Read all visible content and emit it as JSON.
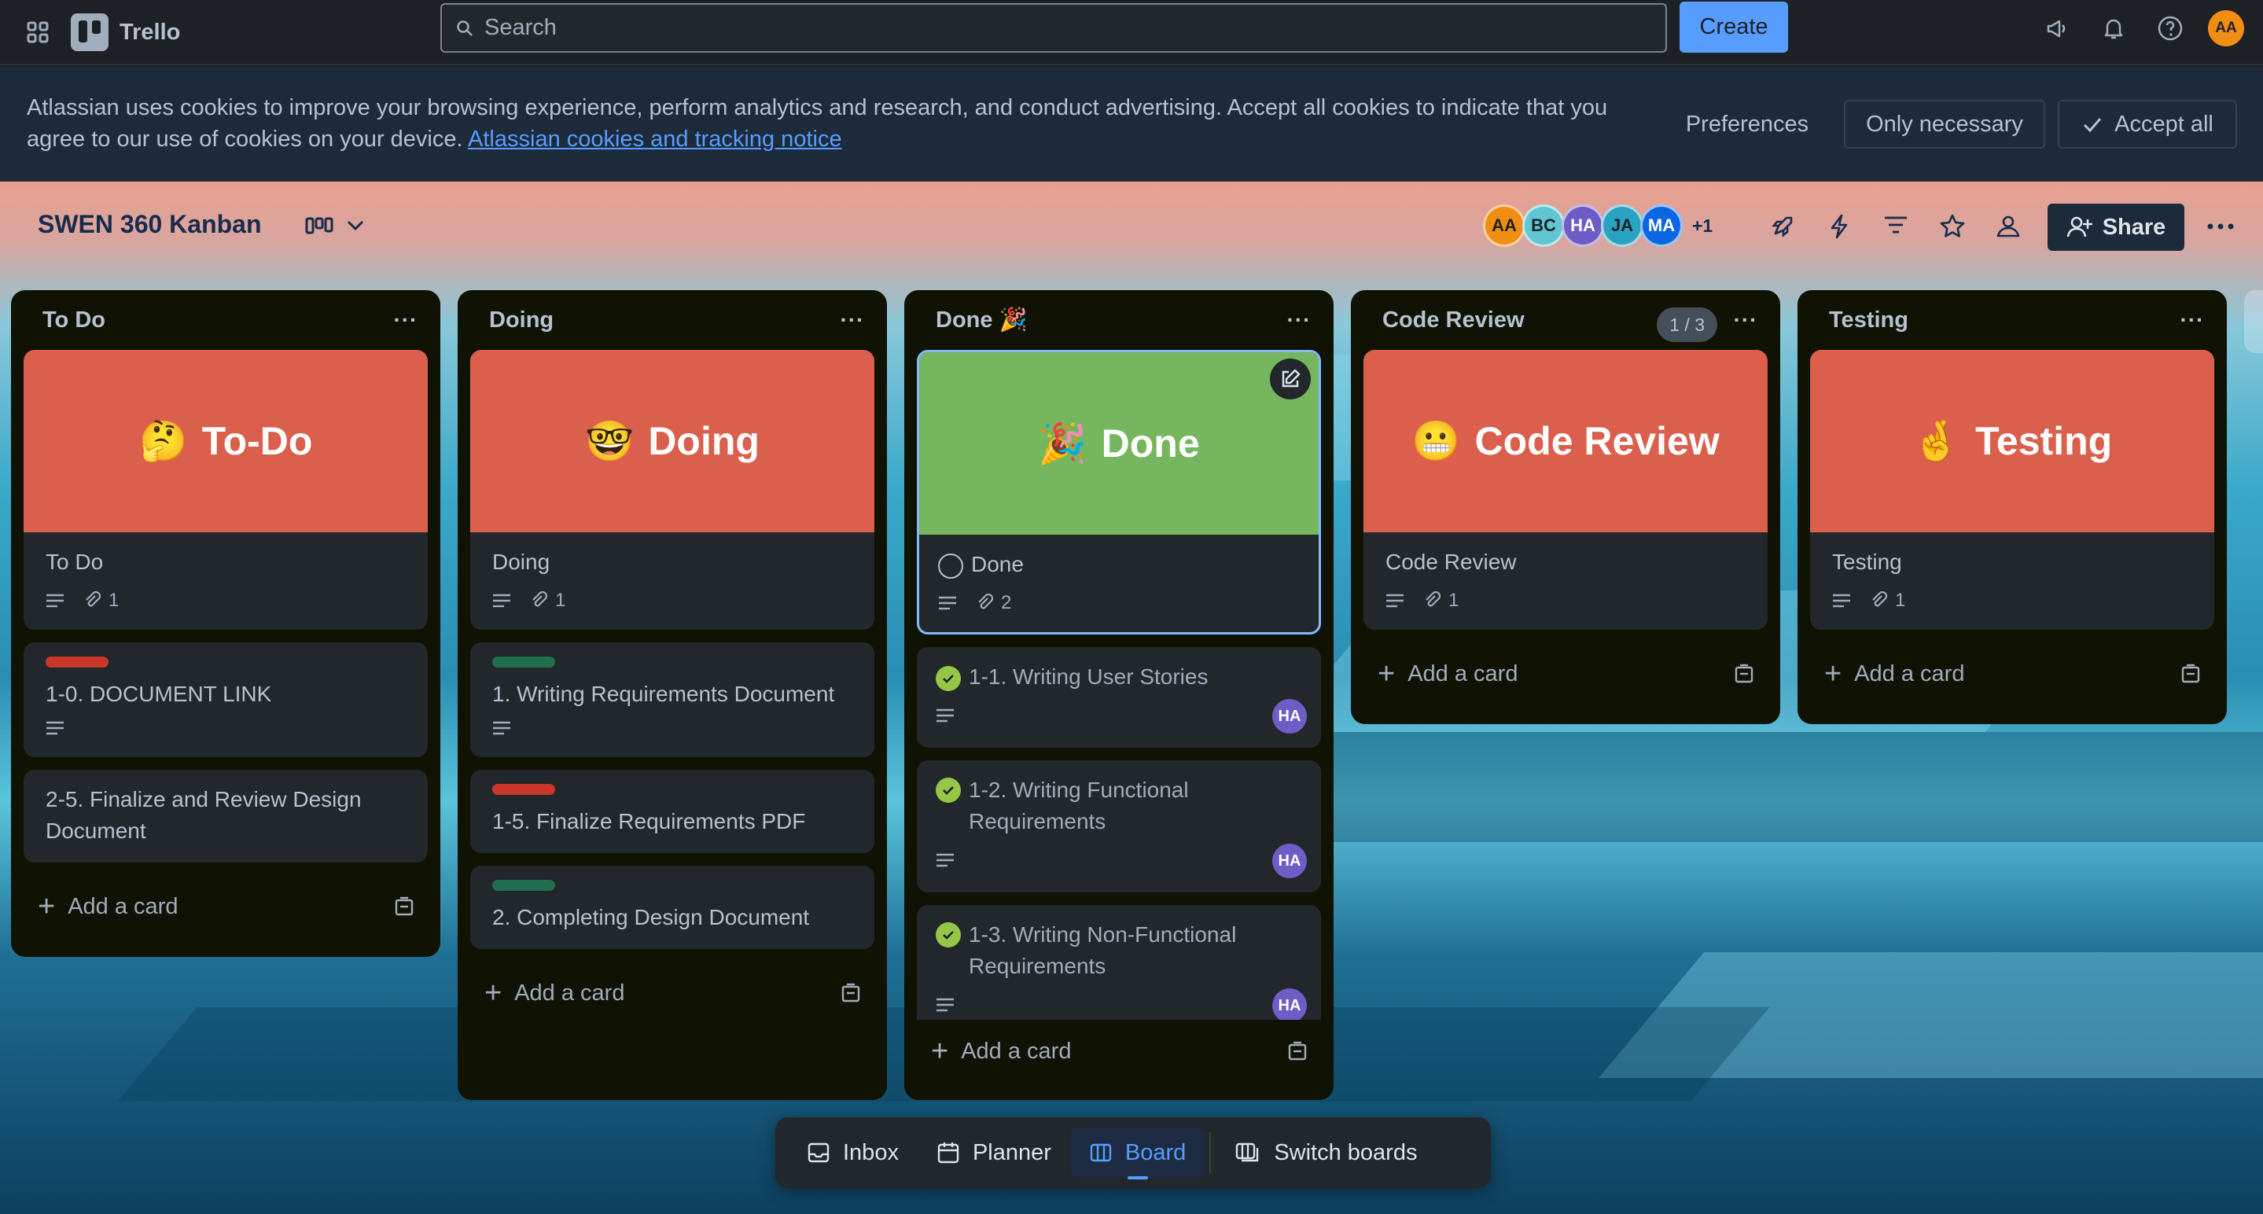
{
  "topbar": {
    "app_name": "Trello",
    "search_placeholder": "Search",
    "create_label": "Create",
    "user_initials": "AA"
  },
  "cookie_banner": {
    "text": "Atlassian uses cookies to improve your browsing experience, perform analytics and research, and conduct advertising. Accept all cookies to indicate that you agree to our use of cookies on your device.",
    "link": "Atlassian cookies and tracking notice",
    "preferences": "Preferences",
    "only_necessary": "Only necessary",
    "accept_all": "Accept all"
  },
  "board": {
    "title": "SWEN 360 Kanban",
    "members": [
      {
        "initials": "AA",
        "color": "#f18d13"
      },
      {
        "initials": "BC",
        "color": "#60c6d2"
      },
      {
        "initials": "HA",
        "color": "#6e5dc6"
      },
      {
        "initials": "JA",
        "color": "#29a3c1"
      },
      {
        "initials": "MA",
        "color": "#0c66e4"
      }
    ],
    "more_members": "+1",
    "share_label": "Share"
  },
  "lists": [
    {
      "title": "To Do",
      "cover_card": {
        "cover_emoji": "🤔",
        "cover_text": "To-Do",
        "title": "To Do",
        "attachments": "1"
      },
      "cards": [
        {
          "title": "1-0. DOCUMENT LINK"
        },
        {
          "title": "2-5. Finalize and Review Design Document"
        }
      ],
      "add_label": "Add a card"
    },
    {
      "title": "Doing",
      "cover_card": {
        "cover_emoji": "🤓",
        "cover_text": "Doing",
        "title": "Doing",
        "attachments": "1"
      },
      "cards": [
        {
          "title": "1. Writing Requirements Document"
        },
        {
          "title": "1-5. Finalize Requirements PDF"
        },
        {
          "title": "2. Completing Design Document"
        }
      ],
      "add_label": "Add a card"
    },
    {
      "title": "Done 🎉",
      "cover_card": {
        "cover_emoji": "🎉",
        "cover_text": "Done",
        "title": "Done",
        "attachments": "2"
      },
      "cards": [
        {
          "title": "1-1. Writing User Stories",
          "member": "HA"
        },
        {
          "title": "1-2. Writing Functional Requirements",
          "member": "HA"
        },
        {
          "title": "1-3. Writing Non-Functional Requirements",
          "member": "HA"
        }
      ],
      "add_label": "Add a card"
    },
    {
      "title": "Code Review",
      "count": "1 / 3",
      "cover_card": {
        "cover_emoji": "😬",
        "cover_text": "Code Review",
        "title": "Code Review",
        "attachments": "1"
      },
      "add_label": "Add a card"
    },
    {
      "title": "Testing",
      "cover_card": {
        "cover_emoji": "🤞",
        "cover_text": "Testing",
        "title": "Testing",
        "attachments": "1"
      },
      "add_label": "Add a card"
    }
  ],
  "bottom_nav": {
    "inbox": "Inbox",
    "planner": "Planner",
    "board": "Board",
    "switch": "Switch boards"
  },
  "colors": {
    "label_red": "#c9372c",
    "label_green": "#216e4e",
    "cover_red": "#da5f4c",
    "cover_green": "#75b65f",
    "accent": "#579dff"
  }
}
